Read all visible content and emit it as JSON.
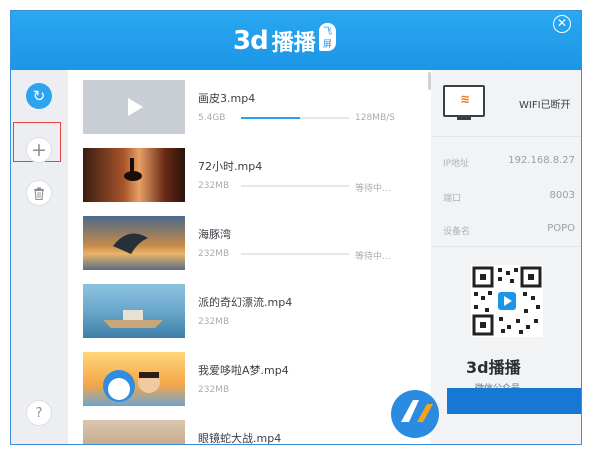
{
  "app": {
    "logo_text": "3d",
    "logo_name": "播播",
    "logo_badge": "飞屏",
    "close_glyph": "✕"
  },
  "sidebar": {
    "refresh_glyph": "↻",
    "add_glyph": "+",
    "trash_glyph": "🗑",
    "help_glyph": "?"
  },
  "videos": [
    {
      "name": "画皮3.mp4",
      "size": "5.4GB",
      "status": "128MB/S",
      "progress": 0.55
    },
    {
      "name": "72小时.mp4",
      "size": "232MB",
      "status": "等待中...",
      "progress": 0
    },
    {
      "name": "海豚湾",
      "size": "232MB",
      "status": "等待中...",
      "progress": 0
    },
    {
      "name": "派的奇幻漂流.mp4",
      "size": "232MB",
      "status": "",
      "progress": 0
    },
    {
      "name": "我爱哆啦A梦.mp4",
      "size": "232MB",
      "status": "",
      "progress": 0
    },
    {
      "name": "眼镜蛇大战.mp4",
      "size": "",
      "status": "",
      "progress": 0
    }
  ],
  "panel": {
    "wifi_status": "WIFI已断开",
    "ip_label": "IP地址",
    "ip_value": "192.168.8.27",
    "port_label": "端口",
    "port_value": "8003",
    "device_label": "设备名",
    "device_value": "POPO",
    "qr_logo": "3d播播",
    "qr_caption": "微信公众号"
  },
  "colors": {
    "accent": "#1b95e6",
    "highlight_border": "#e5443e"
  }
}
